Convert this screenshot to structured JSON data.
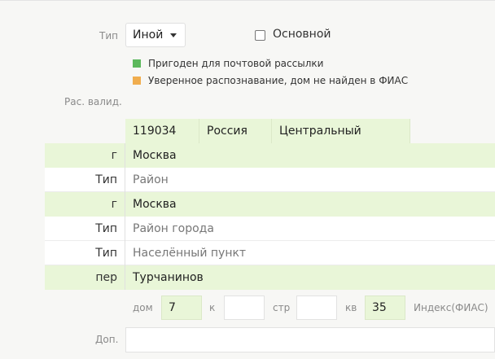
{
  "type": {
    "label": "Тип",
    "value": "Иной",
    "main_label": "Основной"
  },
  "validation": {
    "label": "Рас. валид.",
    "items": [
      {
        "color": "#5cb85c",
        "text": "Пригоден для почтовой рассылки"
      },
      {
        "color": "#f0ad4e",
        "text": "Уверенное распознавание, дом не найден в ФИАС"
      }
    ]
  },
  "header_cells": [
    "119034",
    "Россия",
    "Центральный"
  ],
  "rows": [
    {
      "label": "г",
      "value": "Москва",
      "state": "filled"
    },
    {
      "label": "Тип",
      "value": "Район",
      "state": "empty"
    },
    {
      "label": "г",
      "value": "Москва",
      "state": "filled"
    },
    {
      "label": "Тип",
      "value": "Район города",
      "state": "empty"
    },
    {
      "label": "Тип",
      "value": "Населённый пункт",
      "state": "empty"
    },
    {
      "label": "пер",
      "value": "Турчанинов",
      "state": "filled"
    }
  ],
  "house": {
    "dom_label": "дом",
    "dom_value": "7",
    "k_label": "к",
    "k_value": "",
    "str_label": "стр",
    "str_value": "",
    "kv_label": "кв",
    "kv_value": "35",
    "index_label": "Индекс(ФИАС)"
  },
  "extra": {
    "label": "Доп.",
    "value": ""
  },
  "colors": {
    "filled_bg": "#e9f6d8",
    "green_marker": "#5cb85c",
    "orange_marker": "#f0ad4e"
  }
}
